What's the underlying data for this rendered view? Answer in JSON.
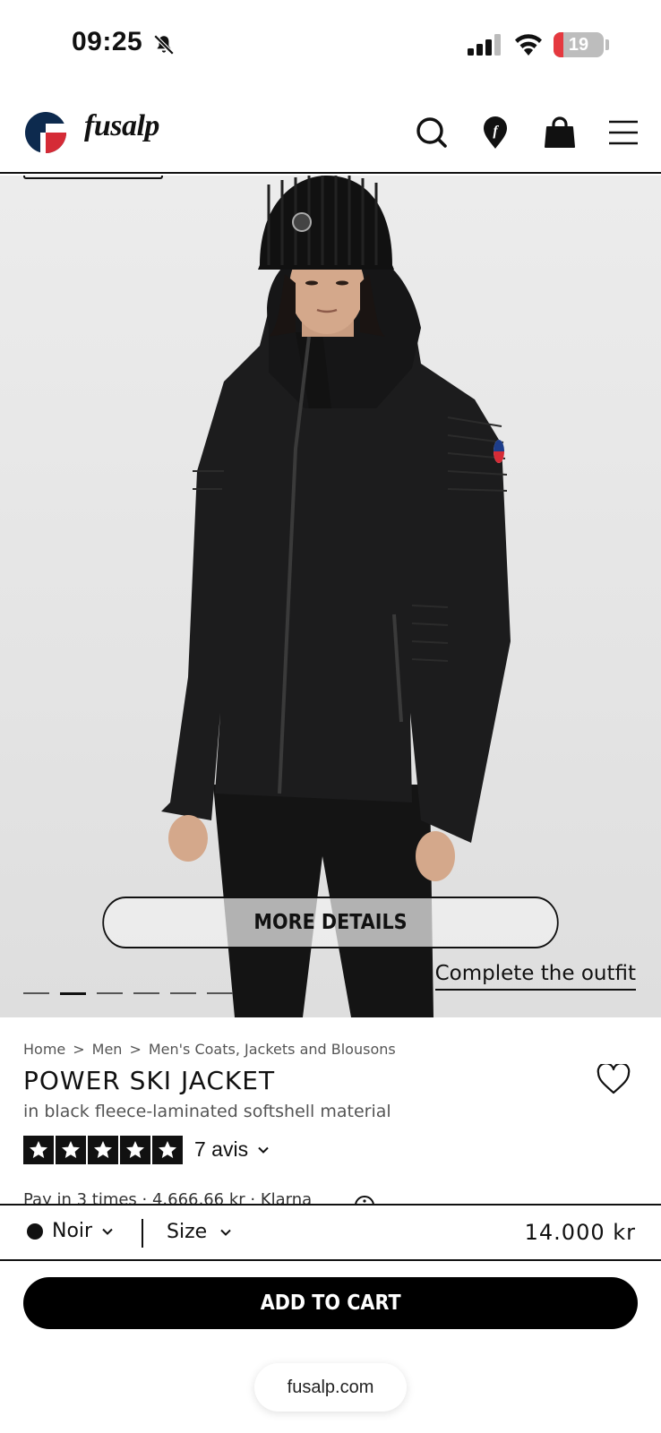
{
  "status_bar": {
    "time": "09:25",
    "battery": "19",
    "battery_level": 0.19,
    "icons": [
      "bell-slash-icon",
      "cellular-signal-icon",
      "wifi-icon",
      "battery-charging-icon"
    ]
  },
  "header": {
    "brand": "fusalp",
    "icons": [
      "search-icon",
      "store-locator-icon",
      "shopping-bag-icon",
      "menu-icon"
    ]
  },
  "hero": {
    "more_details_label": "MORE DETAILS",
    "complete_outfit_label": "Complete the outfit",
    "slide_count": 6,
    "active_slide": 2
  },
  "breadcrumb": [
    "Home",
    ">",
    "Men",
    ">",
    "Men's Coats, Jackets and Blousons"
  ],
  "product": {
    "title": "POWER SKI JACKET",
    "subtitle": "in black fleece-laminated softshell material",
    "rating": 5,
    "reviews_label": "7 avis",
    "installments_peek": "Pay in 3 times · 4.666,66 kr · Klarna"
  },
  "selector": {
    "color_label": "Noir",
    "size_label": "Size",
    "price": "14.000 kr"
  },
  "cta": {
    "add_to_cart_label": "ADD TO CART"
  },
  "browser": {
    "url": "fusalp.com"
  },
  "colors": {
    "brand_red": "#d52b36",
    "brand_navy": "#0d2a4e",
    "ink": "#111111"
  }
}
